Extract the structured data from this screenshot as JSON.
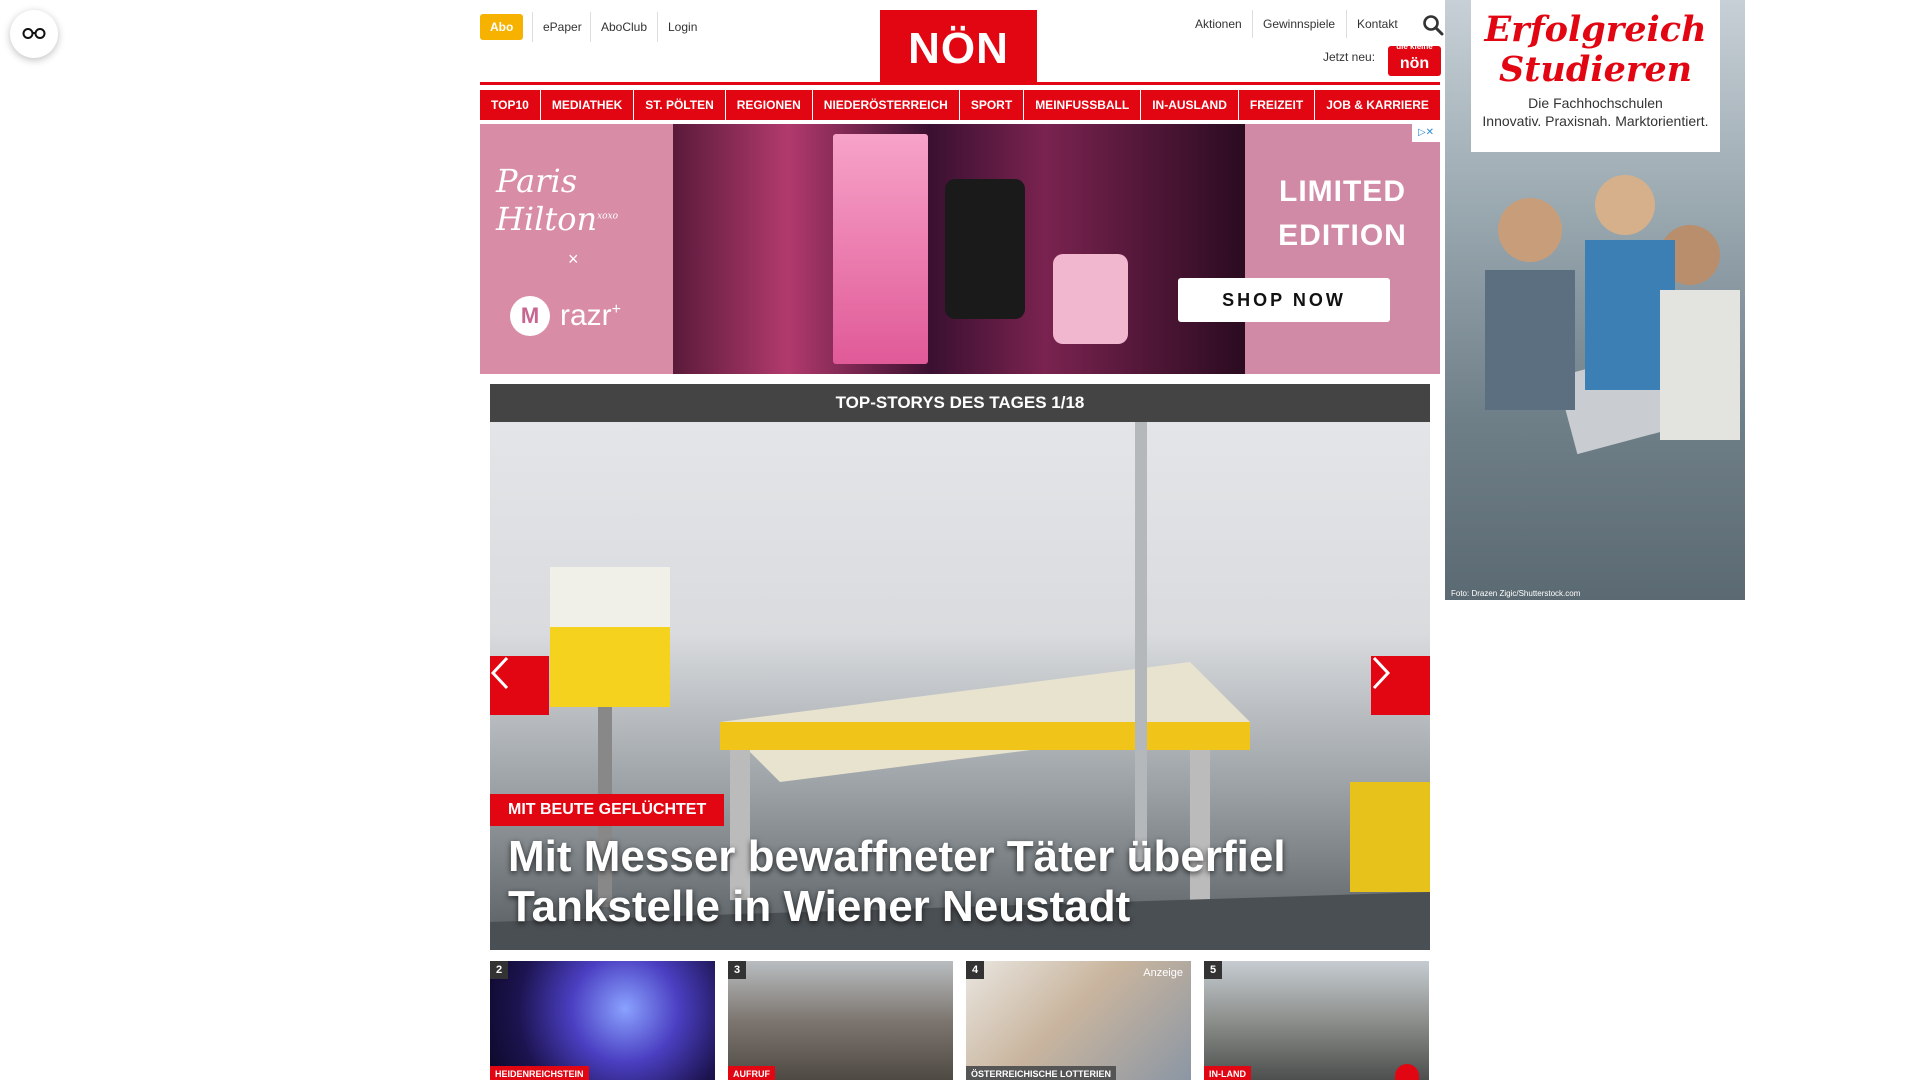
{
  "reader_button": {
    "icon": "glasses-icon"
  },
  "header": {
    "abo": "Abo",
    "links": [
      "ePaper",
      "AboClub",
      "Login"
    ],
    "logo": "NÖN",
    "right_links": [
      "Aktionen",
      "Gewinnspiele",
      "Kontakt"
    ],
    "jetzt_neu": "Jetzt neu:",
    "badge_small": "die kleine",
    "badge_text": "nön"
  },
  "nav": [
    "TOP10",
    "MEDIATHEK",
    "ST. PÖLTEN",
    "REGIONEN",
    "NIEDERÖSTERREICH",
    "SPORT",
    "MEINFUSSBALL",
    "IN-AUSLAND",
    "FREIZEIT",
    "JOB & KARRIERE"
  ],
  "banner": {
    "brand": "Paris Hilton",
    "brand_suffix": "xoxo",
    "x": "×",
    "product": "razr",
    "product_suffix": "+",
    "headline_1": "LIMITED",
    "headline_2": "EDITION",
    "cta": "SHOP NOW",
    "ad_choice": "▷✕"
  },
  "stories": {
    "header": "TOP-STORYS DES TAGES 1/18",
    "hero": {
      "kicker": "MIT BEUTE GEFLÜCHTET",
      "title": "Mit Messer bewaffneter Täter überfiel Tankstelle in Wiener Neustadt"
    },
    "thumbs": [
      {
        "num": "2",
        "tag": "HEIDENREICHSTEIN",
        "gray": false
      },
      {
        "num": "3",
        "tag": "AUFRUF",
        "gray": false
      },
      {
        "num": "4",
        "tag": "ÖSTERREICHISCHE LOTTERIEN",
        "gray": true,
        "anzeige": "Anzeige"
      },
      {
        "num": "5",
        "tag": "IN-LAND",
        "gray": false
      }
    ]
  },
  "sky_ad": {
    "title_1": "Erfolgreich",
    "title_2": "Studieren",
    "sub_1": "Die Fachhochschulen",
    "sub_2": "Innovativ. Praxisnah. Marktorientiert.",
    "credit": "Foto: Drazen Zigic/Shutterstock.com"
  }
}
